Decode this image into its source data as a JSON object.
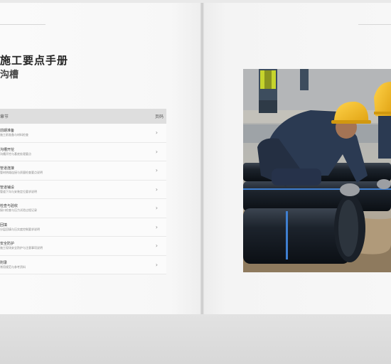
{
  "document": {
    "title": "施工要点手册",
    "subtitle": "沟槽"
  },
  "contents": {
    "header_left": "章节",
    "header_right": "页码",
    "items": [
      {
        "title": "前期准备",
        "desc": "施工前准备与材料检查"
      },
      {
        "title": "沟槽开挖",
        "desc": "沟槽开挖与基底处理要点"
      },
      {
        "title": "管道连接",
        "desc": "管材热熔连接与质量检查要点说明"
      },
      {
        "title": "管道铺设",
        "desc": "管道下沟与安装定位要求说明"
      },
      {
        "title": "检查与验收",
        "desc": "接口检查与压力试验过程记录"
      },
      {
        "title": "回填",
        "desc": "分层回填与压实度控制要求说明"
      },
      {
        "title": "安全防护",
        "desc": "施工现场安全防护与注意事项说明"
      },
      {
        "title": "附录",
        "desc": "常用规范与参考资料"
      }
    ],
    "chevron": "›"
  },
  "photo": {
    "icon": "pipeline-workers-photo"
  }
}
